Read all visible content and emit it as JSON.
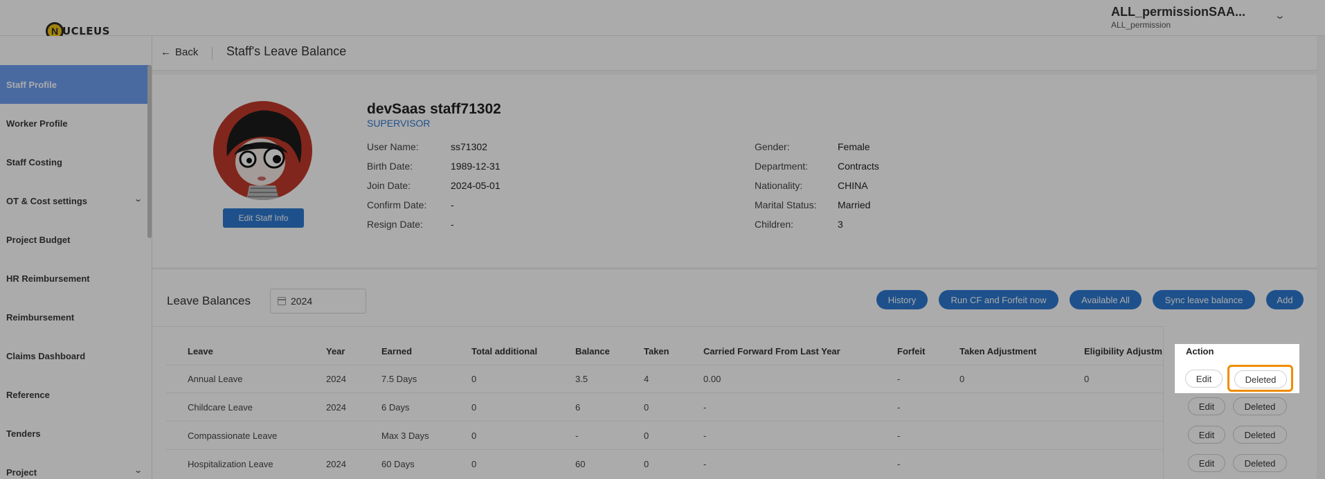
{
  "app": {
    "logo_letter": "N",
    "logo_text": "UCLEUS",
    "user_name": "ALL_permissionSAA...",
    "user_role": "ALL_permission"
  },
  "sidebar": {
    "items": [
      {
        "label": "Staff Profile",
        "active": true
      },
      {
        "label": "Worker Profile"
      },
      {
        "label": "Staff Costing"
      },
      {
        "label": "OT & Cost settings",
        "has_chevron": true
      },
      {
        "label": "Project Budget"
      },
      {
        "label": "HR Reimbursement"
      },
      {
        "label": "Reimbursement"
      },
      {
        "label": "Claims Dashboard"
      },
      {
        "label": "Reference"
      },
      {
        "label": "Tenders"
      },
      {
        "label": "Project",
        "has_chevron": true
      }
    ]
  },
  "header": {
    "back_label": "Back",
    "title": "Staff's Leave Balance"
  },
  "profile": {
    "name": "devSaas staff71302",
    "role": "SUPERVISOR",
    "edit_button": "Edit Staff Info",
    "left_fields": [
      {
        "label": "User Name:",
        "value": "ss71302"
      },
      {
        "label": "Birth Date:",
        "value": "1989-12-31"
      },
      {
        "label": "Join Date:",
        "value": "2024-05-01"
      },
      {
        "label": "Confirm Date:",
        "value": "-"
      },
      {
        "label": "Resign Date:",
        "value": "-"
      }
    ],
    "right_fields": [
      {
        "label": "Gender:",
        "value": "Female"
      },
      {
        "label": "Department:",
        "value": "Contracts"
      },
      {
        "label": "Nationality:",
        "value": "CHINA"
      },
      {
        "label": "Marital Status:",
        "value": "Married"
      },
      {
        "label": "Children:",
        "value": "3"
      }
    ]
  },
  "leave": {
    "title": "Leave Balances",
    "year": "2024",
    "buttons": {
      "history": "History",
      "run_cf": "Run CF and Forfeit now",
      "available_all": "Available All",
      "sync": "Sync leave balance",
      "add": "Add"
    },
    "columns": [
      "Leave",
      "Year",
      "Earned",
      "Total additional",
      "Balance",
      "Taken",
      "Carried Forward From Last Year",
      "Forfeit",
      "Taken Adjustment",
      "Eligibility Adjustm",
      "Action"
    ],
    "rows": [
      [
        "Annual Leave",
        "2024",
        "7.5 Days",
        "0",
        "3.5",
        "4",
        "0.00",
        "-",
        "0",
        "0"
      ],
      [
        "Childcare Leave",
        "2024",
        "6 Days",
        "0",
        "6",
        "0",
        "-",
        "-",
        "",
        ""
      ],
      [
        "Compassionate Leave",
        "",
        "Max 3 Days",
        "0",
        "-",
        "0",
        "-",
        "-",
        "",
        ""
      ],
      [
        "Hospitalization Leave",
        "2024",
        "60 Days",
        "0",
        "60",
        "0",
        "-",
        "-",
        "",
        ""
      ]
    ],
    "edit_label": "Edit",
    "delete_label": "Deleted"
  },
  "colors": {
    "primary": "#2e7ad1",
    "active_nav": "#6e9ff0",
    "highlight": "#f08c00",
    "avatar_bg": "#c0392b"
  }
}
